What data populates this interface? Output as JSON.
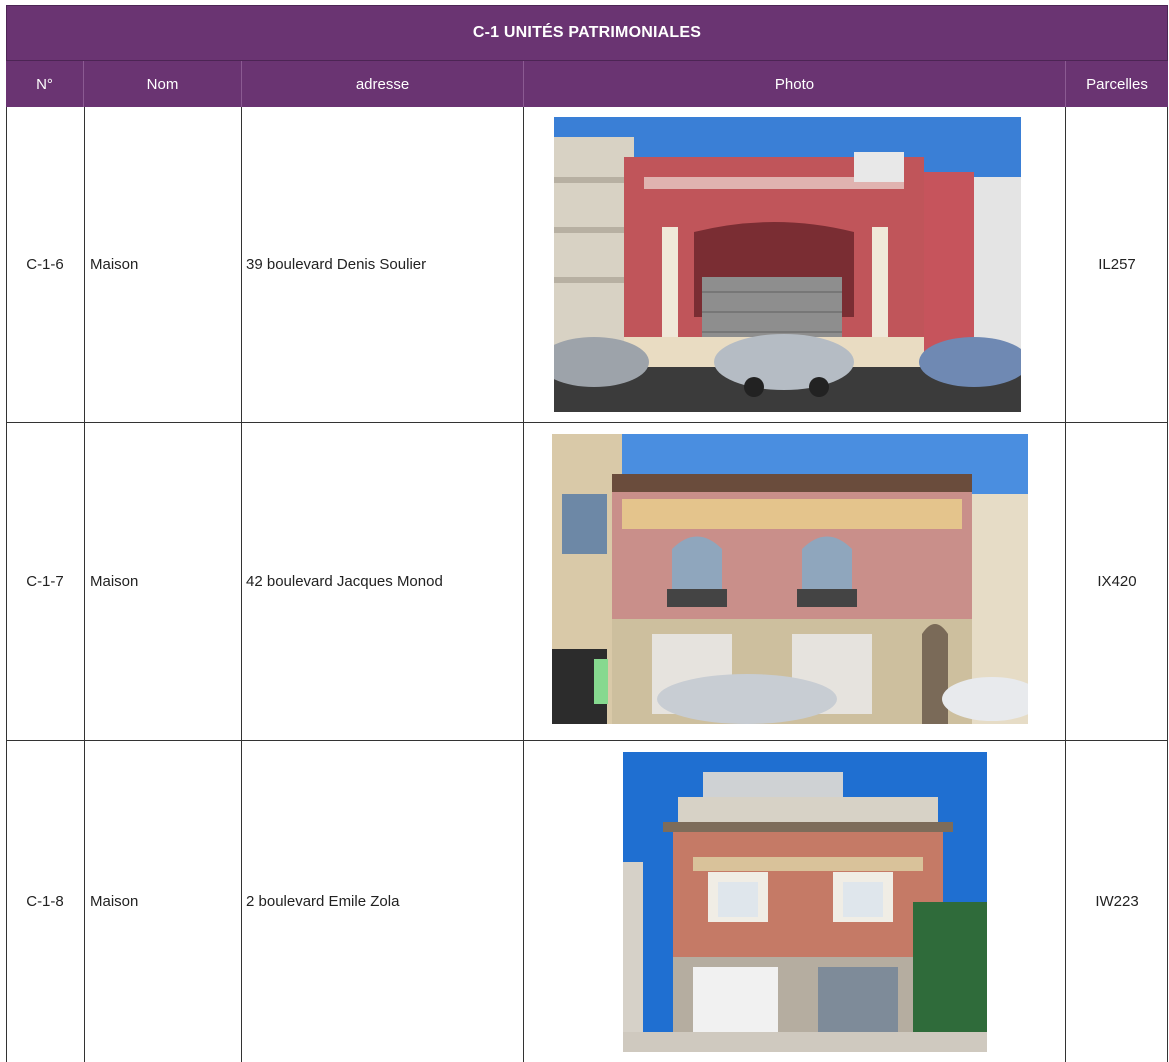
{
  "title": "C-1 UNITÉS PATRIMONIALES",
  "columns": [
    "N°",
    "Nom",
    "adresse",
    "Photo",
    "Parcelles"
  ],
  "rows": [
    {
      "num": "C-1-6",
      "nom": "Maison",
      "adresse": "39 boulevard Denis Soulier",
      "parcelles": "IL257"
    },
    {
      "num": "C-1-7",
      "nom": "Maison",
      "adresse": "42 boulevard Jacques Monod",
      "parcelles": "IX420"
    },
    {
      "num": "C-1-8",
      "nom": "Maison",
      "adresse": "2 boulevard Emile Zola",
      "parcelles": "IW223"
    }
  ],
  "colors": {
    "header": "#6a3472",
    "border": "#333333"
  }
}
